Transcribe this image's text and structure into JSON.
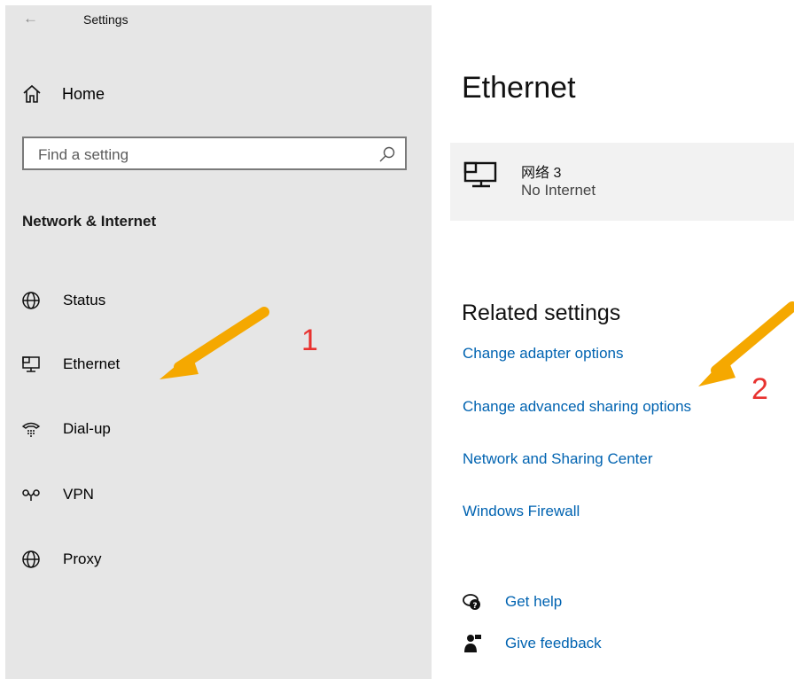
{
  "window": {
    "back_glyph": "←",
    "title": "Settings"
  },
  "sidebar": {
    "home_label": "Home",
    "search_placeholder": "Find a setting",
    "section_title": "Network & Internet",
    "items": [
      {
        "label": "Status",
        "icon": "status-globe-icon"
      },
      {
        "label": "Ethernet",
        "icon": "ethernet-icon"
      },
      {
        "label": "Dial-up",
        "icon": "dialup-phone-icon"
      },
      {
        "label": "VPN",
        "icon": "vpn-icon"
      },
      {
        "label": "Proxy",
        "icon": "proxy-globe-icon"
      }
    ]
  },
  "main": {
    "title": "Ethernet",
    "network": {
      "name": "网络 3",
      "status": "No Internet",
      "icon": "ethernet-icon"
    },
    "related_title": "Related settings",
    "links": [
      "Change adapter options",
      "Change advanced sharing options",
      "Network and Sharing Center",
      "Windows Firewall"
    ],
    "help": [
      {
        "label": "Get help",
        "icon": "help-chat-icon"
      },
      {
        "label": "Give feedback",
        "icon": "feedback-person-icon"
      }
    ]
  },
  "annotations": {
    "step1": "1",
    "step2": "2",
    "arrow_color": "#f5a800",
    "number_color": "#e8322f"
  },
  "colors": {
    "link": "#0063b1",
    "sidebar_bg": "#e6e6e6",
    "card_bg": "#f2f2f2"
  }
}
